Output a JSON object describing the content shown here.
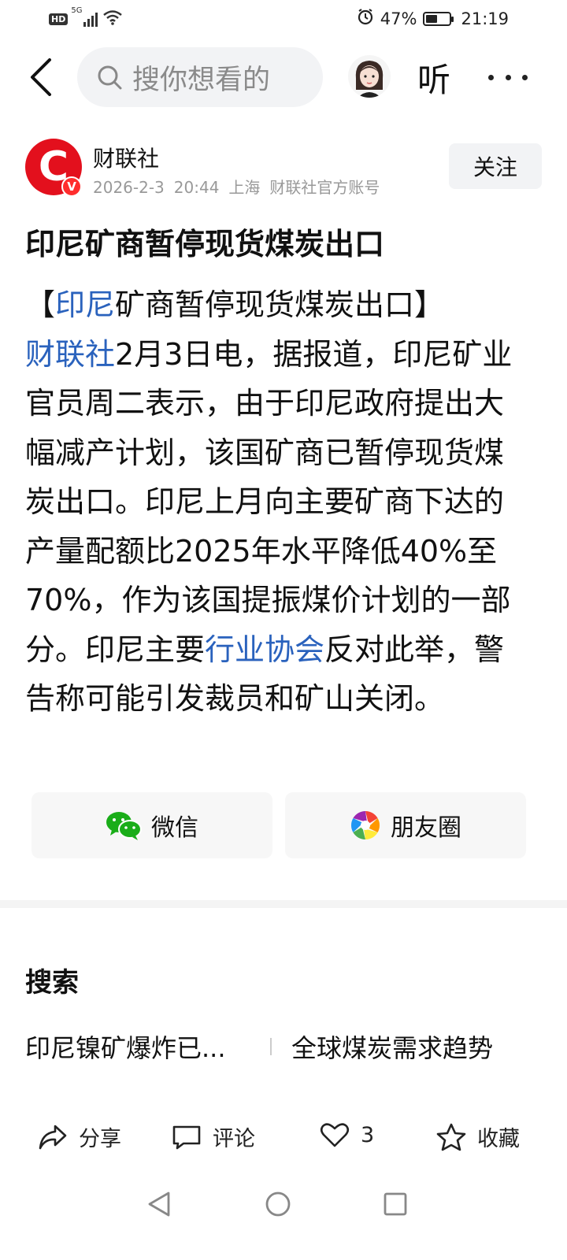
{
  "status_bar": {
    "hd": "HD",
    "network": "5G",
    "battery": "47%",
    "battery_level": 0.47,
    "time": "21:19"
  },
  "nav": {
    "search_placeholder": "搜你想看的",
    "listen_label": "听"
  },
  "author": {
    "logo_letter": "C",
    "verified_badge": "V",
    "name": "财联社",
    "date": "2026-2-3",
    "time": "20:44",
    "location": "上海",
    "account_type": "财联社官方账号",
    "follow_label": "关注"
  },
  "article": {
    "title": "印尼矿商暂停现货煤炭出口",
    "bracket_open": "【",
    "link_indonesia": "印尼",
    "headline_rest": "矿商暂停现货煤炭出口】",
    "link_source": "财联社",
    "body_part1": "2月3日电，据报道，印尼矿业官员周二表示，由于印尼政府提出大幅减产计划，该国矿商已暂停现货煤炭出口。印尼上月向主要矿商下达的产量配额比2025年水平降低40%至70%，作为该国提振煤价计划的一部分。印尼主要",
    "link_association": "行业协会",
    "body_part2": "反对此举，警告称可能引发裁员和矿山关闭。"
  },
  "share": {
    "wechat_label": "微信",
    "moments_label": "朋友圈"
  },
  "search_section": {
    "heading": "搜索",
    "tags": [
      "印尼镍矿爆炸已...",
      "全球煤炭需求趋势"
    ]
  },
  "actions": {
    "share_label": "分享",
    "comment_label": "评论",
    "like_count": "3",
    "favorite_label": "收藏"
  }
}
